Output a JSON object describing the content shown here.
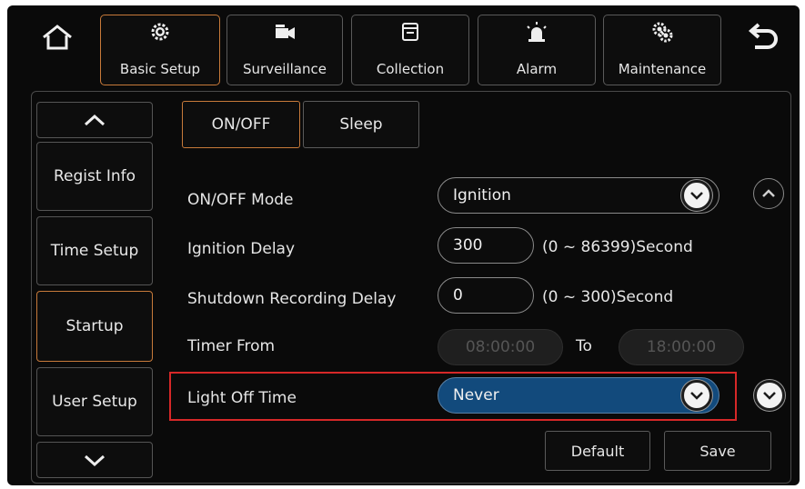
{
  "topbar": {
    "tabs": [
      {
        "label": "Basic Setup",
        "icon": "gear-icon",
        "active": true
      },
      {
        "label": "Surveillance",
        "icon": "video-camera-icon",
        "active": false
      },
      {
        "label": "Collection",
        "icon": "window-icon",
        "active": false
      },
      {
        "label": "Alarm",
        "icon": "alarm-light-icon",
        "active": false
      },
      {
        "label": "Maintenance",
        "icon": "gears-icon",
        "active": false
      }
    ],
    "home_icon": "home-icon",
    "back_icon": "back-arrow-icon"
  },
  "sidebar": {
    "items": [
      {
        "label": "Regist Info",
        "active": false
      },
      {
        "label": "Time Setup",
        "active": false
      },
      {
        "label": "Startup",
        "active": true
      },
      {
        "label": "User Setup",
        "active": false
      }
    ]
  },
  "subtabs": [
    {
      "label": "ON/OFF",
      "active": true
    },
    {
      "label": "Sleep",
      "active": false
    }
  ],
  "form": {
    "onoff_mode": {
      "label": "ON/OFF Mode",
      "value": "Ignition"
    },
    "ignition_delay": {
      "label": "Ignition Delay",
      "value": "300",
      "hint": "(0 ~ 86399)Second"
    },
    "shutdown_delay": {
      "label": "Shutdown Recording Delay",
      "value": "0",
      "hint": "(0 ~ 300)Second"
    },
    "timer": {
      "label": "Timer From",
      "from": "08:00:00",
      "to_label": "To",
      "to": "18:00:00"
    },
    "light_off": {
      "label": "Light Off Time",
      "value": "Never"
    }
  },
  "buttons": {
    "default_label": "Default",
    "save_label": "Save"
  },
  "colors": {
    "accent_border": "#c77a3a",
    "selected_field": "#124a7c",
    "highlight": "#d62828"
  }
}
